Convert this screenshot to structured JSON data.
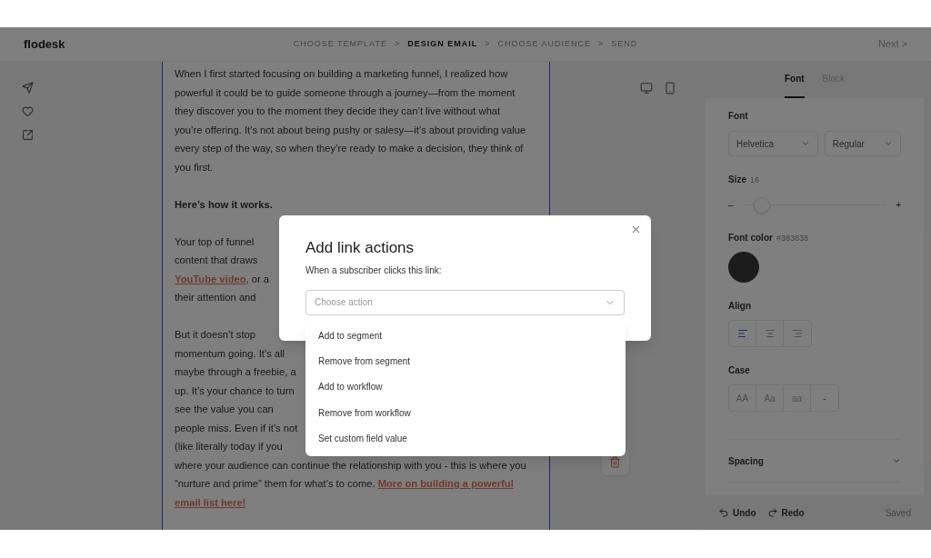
{
  "header": {
    "logo": "flodesk",
    "steps": [
      {
        "label": "CHOOSE TEMPLATE",
        "selected": false
      },
      {
        "label": "DESIGN EMAIL",
        "selected": true
      },
      {
        "label": "CHOOSE AUDIENCE",
        "selected": false
      },
      {
        "label": "SEND",
        "selected": false
      }
    ],
    "separators": [
      ">",
      ">",
      ">"
    ],
    "next": "Next >"
  },
  "email": {
    "paragraphs": [
      {
        "lines": [
          [
            {
              "kind": "text",
              "text": "When I first started focusing on building a marketing funnel, I realized how"
            }
          ],
          [
            {
              "kind": "text",
              "text": "powerful it could be to guide someone through a journey—from the moment"
            }
          ],
          [
            {
              "kind": "text",
              "text": "they discover you to the moment they decide they can’t live without what"
            }
          ],
          [
            {
              "kind": "text",
              "text": "you’re offering. It’s not about being pushy or salesy—it’s about providing value"
            }
          ],
          [
            {
              "kind": "text",
              "text": "every step of the way, so when they’re ready to make a decision, they think of"
            }
          ],
          [
            {
              "kind": "text",
              "text": "you first."
            }
          ]
        ]
      },
      {
        "lines": [
          [
            {
              "kind": "bold",
              "text": "Here’s how it works."
            }
          ]
        ]
      },
      {
        "lines": [
          [
            {
              "kind": "text",
              "text": "Your top of funnel"
            }
          ],
          [
            {
              "kind": "text",
              "text": "content that draws"
            }
          ],
          [
            {
              "kind": "link",
              "text": "YouTube video"
            },
            {
              "kind": "text",
              "text": ", or a"
            }
          ],
          [
            {
              "kind": "text",
              "text": "their attention and"
            }
          ]
        ]
      },
      {
        "lines": [
          [
            {
              "kind": "text",
              "text": "But it doesn’t stop"
            }
          ],
          [
            {
              "kind": "text",
              "text": "momentum going. It’s all"
            }
          ],
          [
            {
              "kind": "text",
              "text": "maybe through a freebie, a"
            }
          ],
          [
            {
              "kind": "text",
              "text": "up. It’s your chance to turn"
            }
          ],
          [
            {
              "kind": "text",
              "text": "see the value you can"
            }
          ],
          [
            {
              "kind": "text",
              "text": "people miss. Even if it’s not"
            }
          ],
          [
            {
              "kind": "text",
              "text": "(like literally today if you"
            }
          ],
          [
            {
              "kind": "text",
              "text": "where your audience can continue the relationship with you - this is where you"
            }
          ],
          [
            {
              "kind": "text",
              "text": "“nurture and prime” them for what’s to come. "
            },
            {
              "kind": "link",
              "text": "More on building a powerful"
            }
          ],
          [
            {
              "kind": "link",
              "text": "email list here!"
            }
          ]
        ]
      }
    ]
  },
  "panel": {
    "tabs": [
      {
        "label": "Font",
        "selected": true
      },
      {
        "label": "Block",
        "selected": false
      }
    ],
    "font_label": "Font",
    "font_family": "Helvetica",
    "font_weight": "Regular",
    "size_label": "Size",
    "size_value": "16",
    "size_minus": "–",
    "size_plus": "+",
    "size": {
      "level": 0.08
    },
    "color_label": "Font color",
    "color_value": "#383838",
    "color": "#383838",
    "align_label": "Align",
    "align": [
      {
        "kind": "left",
        "selected": true
      },
      {
        "kind": "center",
        "selected": false
      },
      {
        "kind": "right",
        "selected": false
      }
    ],
    "case_label": "Case",
    "case": [
      {
        "label": "AA",
        "selected": false
      },
      {
        "label": "Aa",
        "selected": false
      },
      {
        "label": "aa",
        "selected": false
      },
      {
        "label": "-",
        "selected": true
      }
    ],
    "spacing": {
      "label": "Spacing",
      "expanded": false
    },
    "undo": "Undo",
    "redo": "Redo",
    "status": "Saved"
  },
  "modal": {
    "title": "Add link actions",
    "subtitle": "When a subscriber clicks this link:",
    "select": {
      "placeholder": "Choose action",
      "expanded": true
    },
    "options": [
      "Add to segment",
      "Remove from segment",
      "Add to workflow",
      "Remove from workflow",
      "Set custom field value"
    ]
  }
}
